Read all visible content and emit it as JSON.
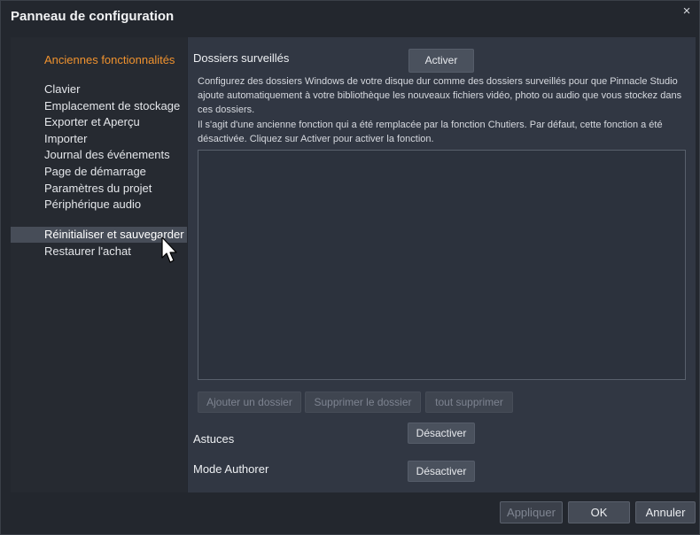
{
  "window": {
    "title": "Panneau de configuration",
    "close_glyph": "×"
  },
  "sidebar": {
    "items": [
      {
        "label": "Anciennes fonctionnalités",
        "state": "active-accent"
      },
      {
        "label": "Clavier"
      },
      {
        "label": "Emplacement de stockage"
      },
      {
        "label": "Exporter et Aperçu"
      },
      {
        "label": "Importer"
      },
      {
        "label": "Journal des événements"
      },
      {
        "label": "Page de démarrage"
      },
      {
        "label": "Paramètres du projet"
      },
      {
        "label": "Périphérique audio"
      },
      {
        "label": "Réinitialiser et sauvegarder",
        "state": "hovered"
      },
      {
        "label": "Restaurer l'achat"
      }
    ]
  },
  "main": {
    "watched_folders": {
      "title": "Dossiers surveillés",
      "activate_label": "Activer",
      "description_1": "Configurez des dossiers Windows de votre disque dur comme des dossiers surveillés pour que Pinnacle Studio ajoute automatiquement à votre bibliothèque les nouveaux fichiers vidéo, photo ou audio que vous stockez dans ces dossiers.",
      "description_2": "Il s'agit d'une ancienne fonction qui a été remplacée par la fonction Chutiers. Par défaut, cette fonction a été désactivée. Cliquez sur Activer pour activer la fonction.",
      "add_folder_label": "Ajouter un dossier",
      "remove_folder_label": "Supprimer le dossier",
      "remove_all_label": "tout supprimer"
    },
    "tips": {
      "title": "Astuces",
      "button_label": "Désactiver"
    },
    "author_mode": {
      "title": "Mode Authorer",
      "button_label": "Désactiver"
    }
  },
  "footer": {
    "apply_label": "Appliquer",
    "ok_label": "OK",
    "cancel_label": "Annuler"
  },
  "colors": {
    "accent": "#f0922e",
    "selected_bg": "#474d58",
    "content_bg": "#313743"
  },
  "icons": {
    "cursor": "mouse-pointer-icon"
  }
}
